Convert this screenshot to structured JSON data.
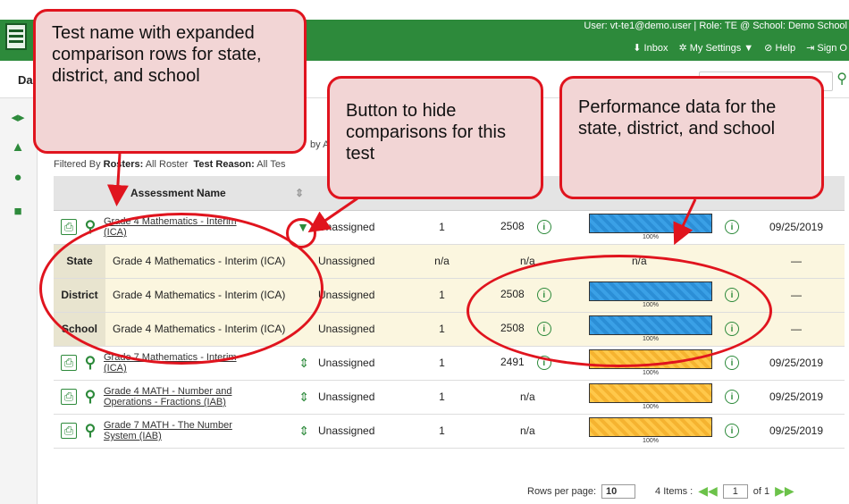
{
  "header": {
    "user_line": "User: vt-te1@demo.user  |  Role: TE @ School: Demo School",
    "links": [
      "Inbox",
      "My Settings ▼",
      "Help",
      "Sign O"
    ]
  },
  "subbar": {
    "label": "Da"
  },
  "context": {
    "filtered_by": "Filtered By",
    "rosters_label": "Rosters:",
    "rosters_value": "All Roster",
    "reason_label": "Test Reason:",
    "reason_value": "All Tes",
    "by_text": "by A"
  },
  "table": {
    "header_name": "Assessment Name",
    "rows": [
      {
        "name": "Grade 4 Mathematics - Interim (ICA)",
        "reason": "Unassigned",
        "tests": "1",
        "score": "2508",
        "perf": "100%",
        "color": "blue",
        "date": "09/25/2019"
      },
      {
        "name": "Grade 7 Mathematics - Interim (ICA)",
        "reason": "Unassigned",
        "tests": "1",
        "score": "2491",
        "perf": "100%",
        "color": "orange",
        "date": "09/25/2019"
      },
      {
        "name": "Grade 4 MATH - Number and Operations - Fractions (IAB)",
        "reason": "Unassigned",
        "tests": "1",
        "score": "n/a",
        "perf": "100%",
        "color": "orange",
        "date": "09/25/2019"
      },
      {
        "name": "Grade 7 MATH - The Number System (IAB)",
        "reason": "Unassigned",
        "tests": "1",
        "score": "n/a",
        "perf": "100%",
        "color": "orange",
        "date": "09/25/2019"
      }
    ],
    "comparisons": [
      {
        "label": "State",
        "name": "Grade 4 Mathematics - Interim (ICA)",
        "reason": "Unassigned",
        "tests": "n/a",
        "score": "n/a",
        "perf": "n/a",
        "date": "—"
      },
      {
        "label": "District",
        "name": "Grade 4 Mathematics - Interim (ICA)",
        "reason": "Unassigned",
        "tests": "1",
        "score": "2508",
        "perf": "100%",
        "date": "—"
      },
      {
        "label": "School",
        "name": "Grade 4 Mathematics - Interim (ICA)",
        "reason": "Unassigned",
        "tests": "1",
        "score": "2508",
        "perf": "100%",
        "date": "—"
      }
    ]
  },
  "footer": {
    "rows_label": "Rows per page:",
    "rows_value": "10",
    "items": "4 Items :",
    "page": "1",
    "of": "of 1"
  },
  "callouts": {
    "c1": "Test name with expanded comparison rows for state, district, and school",
    "c2": "Button to hide comparisons for this test",
    "c3": "Performance data for the state, district, and school"
  },
  "colors": {
    "green": "#2d8a3b",
    "annotation_red": "#e0141e",
    "bar_blue": "#3aa0e6",
    "bar_orange": "#ffc84a"
  }
}
